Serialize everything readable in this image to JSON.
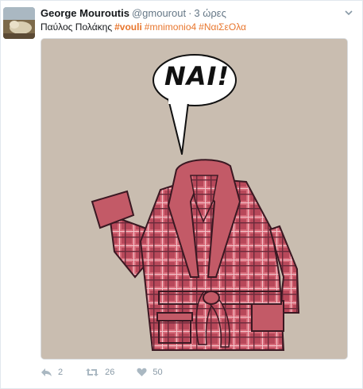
{
  "tweet": {
    "author": {
      "name": "George Mouroutis",
      "handle": "@gmourout",
      "separator": "·",
      "time": "3 ώρες"
    },
    "text": {
      "lead": "Παύλος Πολάκης",
      "hashtags": [
        "#vouli",
        "#mnimonio4",
        "#ΝαιΣεΟλα"
      ]
    },
    "image": {
      "speech_bubble": "ΝΑΙ!"
    },
    "actions": {
      "reply_count": "2",
      "retweet_count": "26",
      "like_count": "50"
    },
    "icons": {
      "reply": "reply-icon",
      "retweet": "retweet-icon",
      "like": "heart-icon",
      "more": "chevron-down-icon"
    },
    "colors": {
      "hashtag": "#e8762d",
      "muted": "#8899a6",
      "image_background": "#c9bdb0",
      "robe": "#b0414f"
    }
  }
}
